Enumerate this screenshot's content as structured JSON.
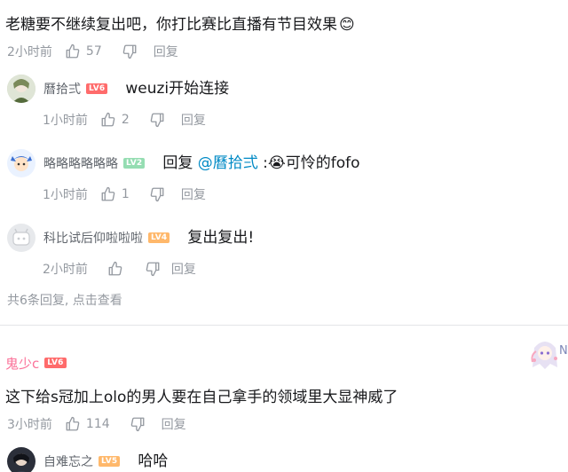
{
  "colors": {
    "level_red": "#ff6b6b",
    "level_green": "#95ddb2",
    "level_yellow": "#ffb86b",
    "username_pink": "#fb7299",
    "link_blue": "#008ac5",
    "meta_gray": "#9499a0"
  },
  "top_comment": {
    "text": "老糖要不继续复出吧，你打比赛比直播有节目效果",
    "emoji": "😊",
    "time": "2小时前",
    "likes": "57",
    "reply_label": "回复"
  },
  "replies": [
    {
      "username": "曆拾弍",
      "level": "LV6",
      "level_color": "red",
      "content": "weuzi开始连接",
      "time": "1小时前",
      "likes": "2",
      "reply_label": "回复"
    },
    {
      "username": "略略略略略略",
      "level": "LV2",
      "level_color": "green",
      "content_prefix": "回复 ",
      "mention": "@曆拾弍",
      "content_sep": " :",
      "emoji": "😭",
      "content_suffix": "可怜的fofo",
      "time": "1小时前",
      "likes": "1",
      "reply_label": "回复"
    },
    {
      "username": "科比试后仰啦啦啦",
      "level": "LV4",
      "level_color": "yellow",
      "content": "复出复出!",
      "time": "2小时前",
      "reply_label": "回复"
    }
  ],
  "view_more": "共6条回复, 点击查看",
  "second_comment": {
    "username": "鬼少c",
    "level": "LV6",
    "text": "这下给s冠加上olo的男人要在自己拿手的领域里大显神威了",
    "time": "3小时前",
    "likes": "114",
    "reply_label": "回复",
    "side_text": "N"
  },
  "partial_reply": {
    "username": "自难忘之",
    "level": "LV5",
    "content": "哈哈"
  },
  "icons": [
    "thumbs-up-icon",
    "thumbs-down-icon"
  ]
}
